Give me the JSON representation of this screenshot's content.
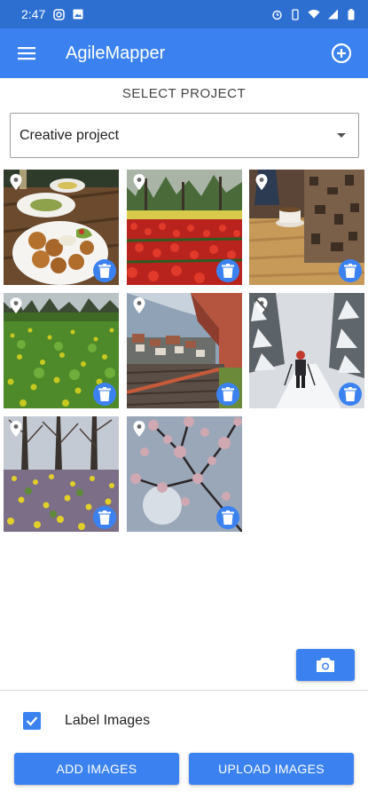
{
  "status_bar": {
    "time": "2:47"
  },
  "app_bar": {
    "title": "AgileMapper"
  },
  "project": {
    "label": "SELECT PROJECT",
    "selected": "Creative project"
  },
  "photos": [
    {
      "subject": "Plate of falafel and salad on a wooden table",
      "location": "pinned"
    },
    {
      "subject": "Field of red tulips with trees",
      "location": "pinned"
    },
    {
      "subject": "Cup on wooden table with a patterned curtain",
      "location": "pinned"
    },
    {
      "subject": "Green meadow with yellow flowers",
      "location": "pinned"
    },
    {
      "subject": "Town seen from a balcony",
      "location": "pinned"
    },
    {
      "subject": "Person hiking on a snowy forest trail",
      "location": "no-location"
    },
    {
      "subject": "Meadow with yellow and purple flowers under trees",
      "location": "pinned"
    },
    {
      "subject": "Blossoming tree branches against the sky",
      "location": "pinned"
    }
  ],
  "options": {
    "label_images": {
      "label": "Label Images",
      "checked": true
    }
  },
  "actions": {
    "add_images": "ADD IMAGES",
    "upload_images": "UPLOAD IMAGES"
  },
  "icons": {
    "menu": "hamburger-menu-icon",
    "add": "add-circle-icon",
    "pin": "location-pin-icon",
    "no_pin": "location-off-icon",
    "trash": "trash-icon",
    "camera": "camera-icon",
    "check": "checkmark-icon"
  },
  "colors": {
    "primary": "#3b82f0",
    "status_bar": "#2c6fd0"
  }
}
